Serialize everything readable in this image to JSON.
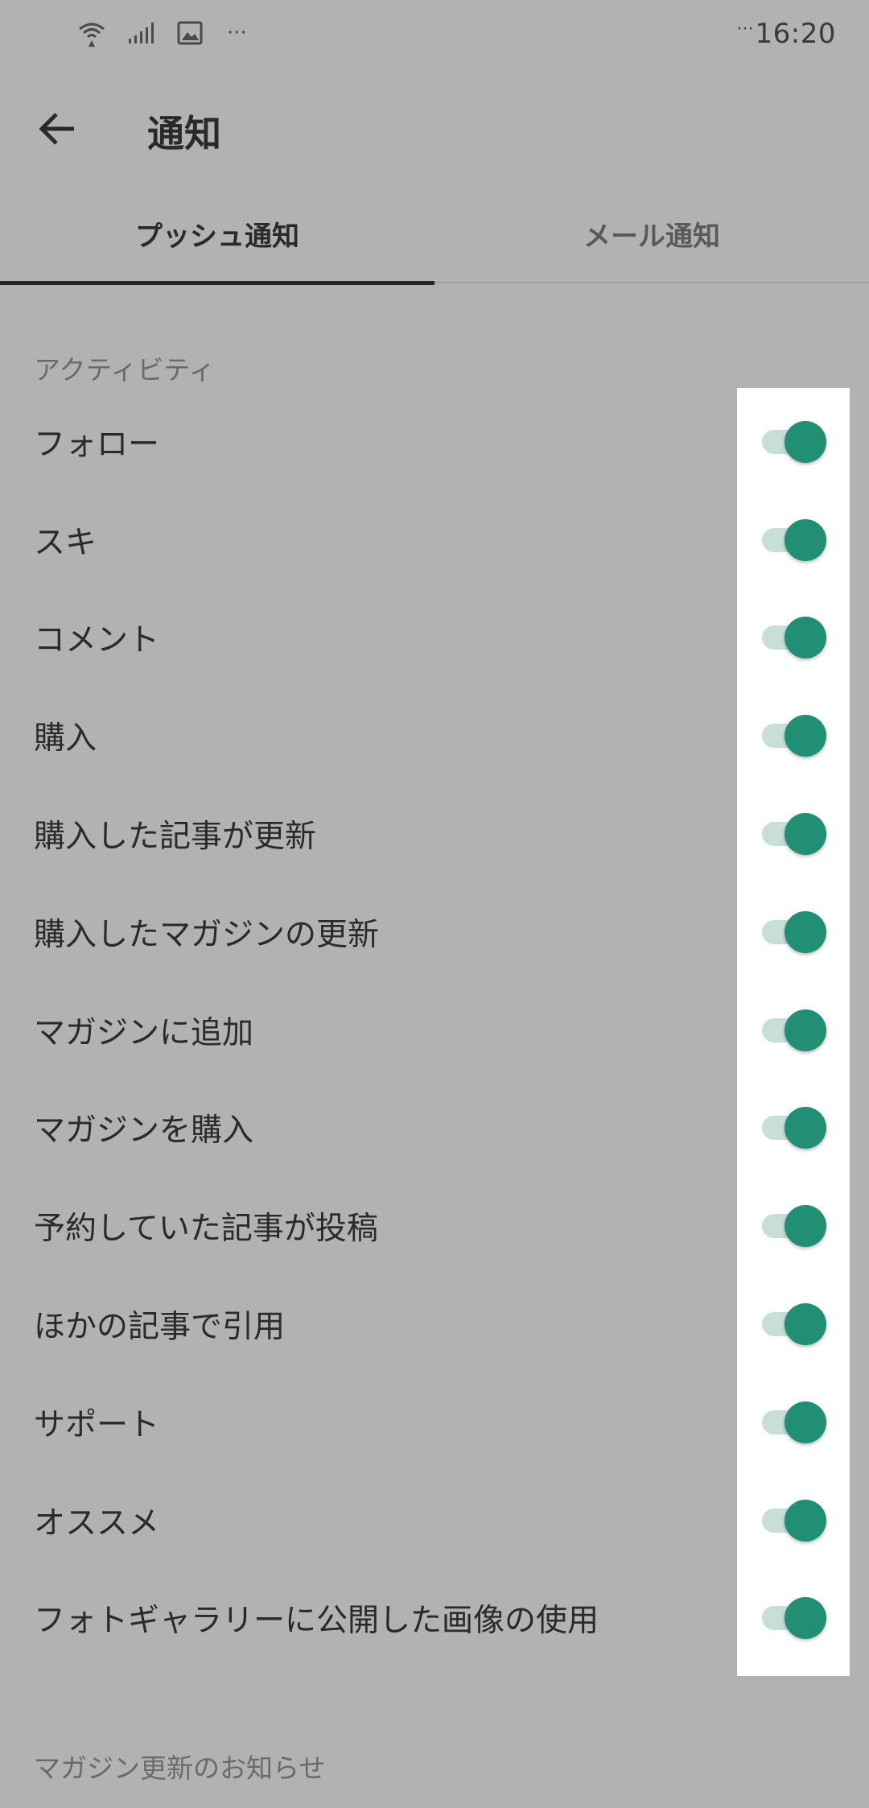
{
  "status_bar": {
    "time": "16:20",
    "left_icons": [
      "wifi-icon",
      "signal-icon",
      "image-icon"
    ],
    "left_more": "···",
    "right_more": "···"
  },
  "app_bar": {
    "title": "通知",
    "back_icon": "arrow-left-icon"
  },
  "tabs": [
    {
      "label": "プッシュ通知",
      "active": true
    },
    {
      "label": "メール通知",
      "active": false
    }
  ],
  "sections": {
    "activity": {
      "title": "アクティビティ",
      "items": [
        {
          "label": "フォロー",
          "enabled": true
        },
        {
          "label": "スキ",
          "enabled": true
        },
        {
          "label": "コメント",
          "enabled": true
        },
        {
          "label": "購入",
          "enabled": true
        },
        {
          "label": "購入した記事が更新",
          "enabled": true
        },
        {
          "label": "購入したマガジンの更新",
          "enabled": true
        },
        {
          "label": "マガジンに追加",
          "enabled": true
        },
        {
          "label": "マガジンを購入",
          "enabled": true
        },
        {
          "label": "予約していた記事が投稿",
          "enabled": true
        },
        {
          "label": "ほかの記事で引用",
          "enabled": true
        },
        {
          "label": "サポート",
          "enabled": true
        },
        {
          "label": "オススメ",
          "enabled": true
        },
        {
          "label": "フォトギャラリーに公開した画像の使用",
          "enabled": true
        }
      ]
    },
    "magazine": {
      "title": "マガジン更新のお知らせ"
    }
  },
  "colors": {
    "background": "#b2b2b2",
    "toggle_thumb": "#218f74",
    "toggle_track": "#c7ded9",
    "highlight_panel": "#ffffff"
  }
}
